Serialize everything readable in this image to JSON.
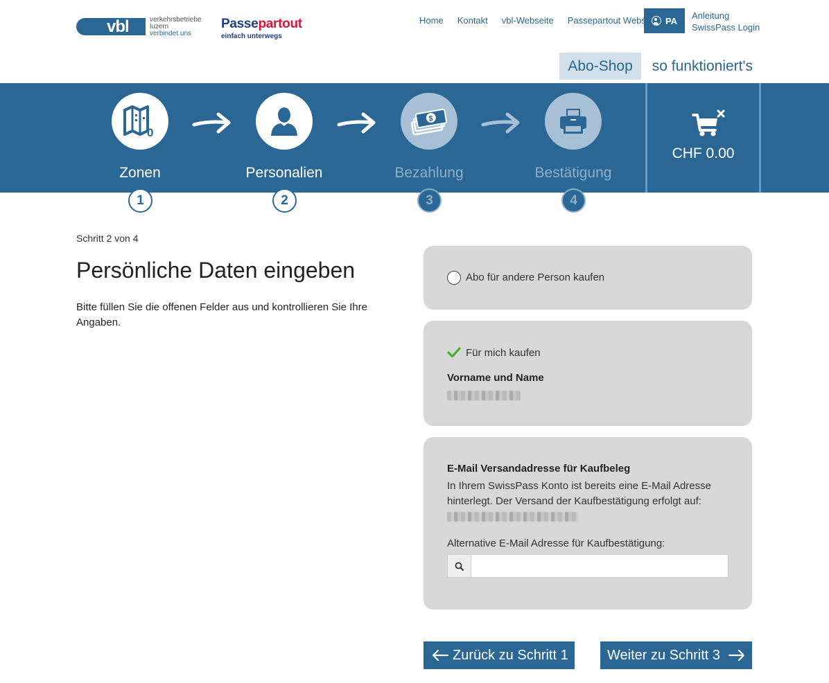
{
  "brand": {
    "vbl_mark": "vbl",
    "vbl_line1": "verkehrsbetriebe",
    "vbl_line2": "luzern",
    "vbl_line3": "verbindet uns",
    "pp_title_a": "Passe",
    "pp_title_b": "partout",
    "pp_sub": "einfach unterwegs"
  },
  "topnav": {
    "home": "Home",
    "kontakt": "Kontakt",
    "vbl": "vbl-Webseite",
    "passepartout": "Passepartout Website",
    "account": "PA",
    "anleitung": "Anleitung",
    "swisspass": "SwissPass Login"
  },
  "subnav": {
    "shop": "Abo-Shop",
    "how": "so funktioniert's"
  },
  "steps": [
    {
      "label": "Zonen",
      "num": "1"
    },
    {
      "label": "Personalien",
      "num": "2"
    },
    {
      "label": "Bezahlung",
      "num": "3"
    },
    {
      "label": "Bestätigung",
      "num": "4"
    }
  ],
  "cart": {
    "total": "CHF 0.00"
  },
  "content": {
    "step_count": "Schritt 2 von 4",
    "title": "Persönliche Daten eingeben",
    "intro": "Bitte füllen Sie die offenen Felder aus und kontrollieren Sie Ihre Angaben."
  },
  "card_other": {
    "label": "Abo für andere Person kaufen"
  },
  "card_self": {
    "label": "Für mich kaufen",
    "name_label": "Vorname und Name"
  },
  "card_email": {
    "title": "E-Mail Versandadresse für Kaufbeleg",
    "desc": "In Ihrem SwissPass Konto ist bereits eine E-Mail Adresse hinterlegt. Der Versand der Kaufbestätigung erfolgt auf:",
    "alt_label": "Alternative E-Mail Adresse für Kaufbestätigung:",
    "alt_value": ""
  },
  "buttons": {
    "back": "Zurück zu Schritt 1",
    "next": "Weiter zu Schritt 3"
  },
  "colors": {
    "primary": "#2b6794",
    "card_bg": "#d8d8d8",
    "check_green": "#4caf2b"
  }
}
